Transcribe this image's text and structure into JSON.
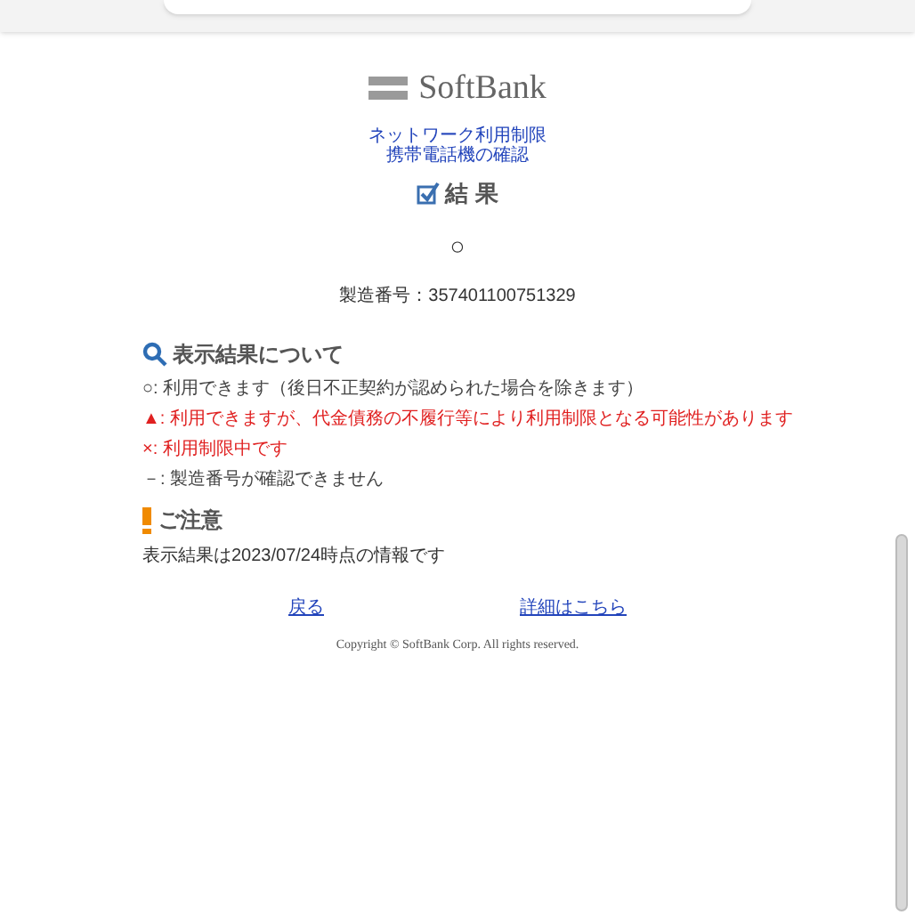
{
  "logo": {
    "text": "SoftBank"
  },
  "subtitle": [
    "ネットワーク利用制限",
    "携帯電話機の確認"
  ],
  "result_heading": "結 果",
  "result": "○",
  "serial": "製造番号：357401100751329",
  "legend": {
    "title": "表示結果について",
    "items": [
      {
        "text": "○: 利用できます（後日不正契約が認められた場合を除きます）",
        "color": "#444444"
      },
      {
        "text": "▲: 利用できますが、代金債務の不履行等により利用制限となる可能性があります",
        "color": "#e02020"
      },
      {
        "text": "×: 利用制限中です",
        "color": "#e02020"
      },
      {
        "text": "－: 製造番号が確認できません",
        "color": "#444444"
      }
    ]
  },
  "notice": {
    "title": "ご注意",
    "text": "表示結果は2023/07/24時点の情報です"
  },
  "links": [
    {
      "label": "戻る"
    },
    {
      "label": "詳細はこちら"
    }
  ],
  "copyright": "Copyright © SoftBank Corp. All rights reserved."
}
